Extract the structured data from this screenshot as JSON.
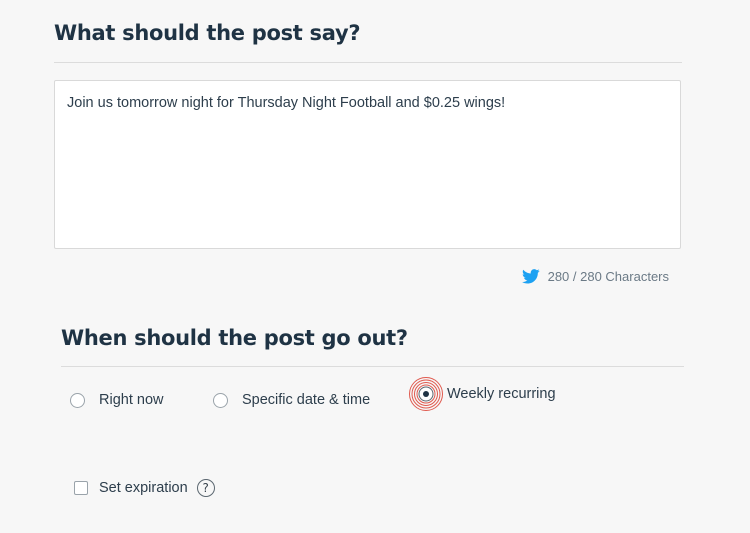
{
  "post_section": {
    "title": "What should the post say?",
    "message_value": "Join us tomorrow night for Thursday Night Football and $0.25 wings!",
    "char_counter": "280 / 280 Characters",
    "counter_icon": "twitter-bird-icon"
  },
  "schedule_section": {
    "title": "When should the post go out?",
    "options": [
      {
        "label": "Right now",
        "selected": false
      },
      {
        "label": "Specific date & time",
        "selected": false
      },
      {
        "label": "Weekly recurring",
        "selected": true
      }
    ],
    "expiration_label": "Set expiration",
    "expiration_checked": false,
    "help_glyph": "?"
  },
  "colors": {
    "heading": "#1f3344",
    "selected_ring": "#e05a4f",
    "twitter_blue": "#1da1f2"
  }
}
